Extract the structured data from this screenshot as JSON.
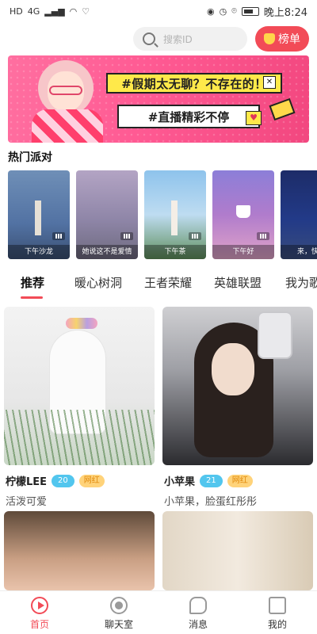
{
  "status_bar": {
    "left_badges": [
      "HD",
      "4G"
    ],
    "time": "晚上8:24"
  },
  "top": {
    "search_placeholder": "搜索ID",
    "rank_label": "榜单"
  },
  "banner": {
    "line1": "#假期太无聊？不存在的！",
    "line1_close": "✕",
    "line2": "#直播精彩不停",
    "heart": "♥"
  },
  "hot_party": {
    "title": "热门派对",
    "cards": [
      {
        "caption": "下午沙龙"
      },
      {
        "caption": "她说这不是爱情"
      },
      {
        "caption": "下午茶"
      },
      {
        "caption": "下午好"
      },
      {
        "caption": "来，快乐"
      }
    ]
  },
  "tabs": [
    "推荐",
    "暖心树洞",
    "王者荣耀",
    "英雄联盟",
    "我为歌"
  ],
  "feed": [
    {
      "name": "柠檬LEE",
      "level": "20",
      "badge": "网红",
      "desc": "活泼可爱"
    },
    {
      "name": "小苹果",
      "level": "21",
      "badge": "网红",
      "desc": "小苹果，脸蛋红彤彤"
    }
  ],
  "bottom_nav": [
    {
      "label": "首页",
      "active": true
    },
    {
      "label": "聊天室",
      "active": false
    },
    {
      "label": "消息",
      "active": false
    },
    {
      "label": "我的",
      "active": false
    }
  ],
  "colors": {
    "accent": "#f24b57",
    "level_blue": "#52c6ee",
    "badge_orange": "#ffd37a"
  }
}
